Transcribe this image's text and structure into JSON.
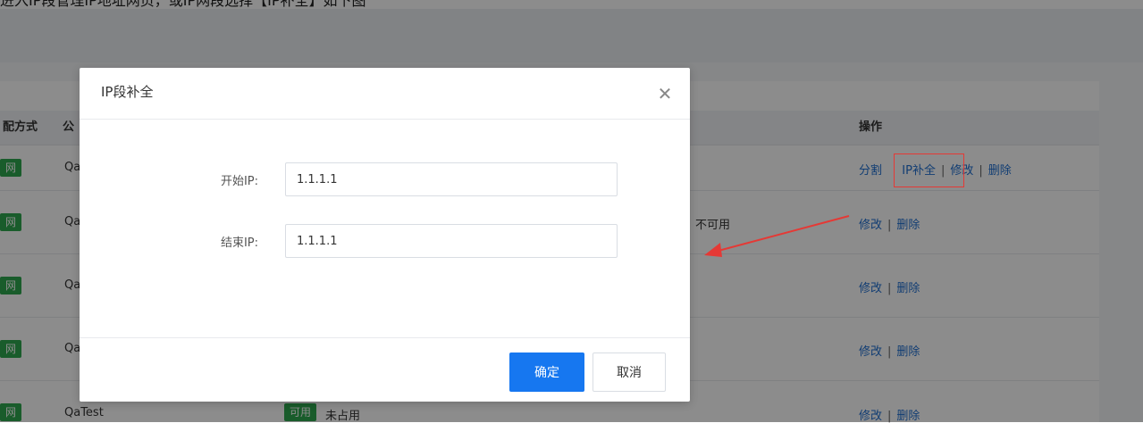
{
  "caption": "进入IP段管理IP地址网页，或IP网段选择【IP补全】如下图",
  "table": {
    "columns": [
      {
        "label": "配方式"
      },
      {
        "label": "公"
      },
      {
        "label": "操作"
      }
    ],
    "rows": [
      {
        "tag": "网",
        "name": "Qa",
        "status": "",
        "ops": [
          "分割",
          "IP补全",
          "修改",
          "删除"
        ]
      },
      {
        "tag": "网",
        "name": "Qa",
        "status": "不可用",
        "ops": [
          "修改",
          "删除"
        ]
      },
      {
        "tag": "网",
        "name": "Qa",
        "status": "",
        "ops": [
          "修改",
          "删除"
        ]
      },
      {
        "tag": "网",
        "name": "Qa",
        "status": "",
        "ops": [
          "修改",
          "删除"
        ]
      },
      {
        "tag": "网",
        "name": "QaTest",
        "badge": "可用",
        "status": "未占用",
        "ops": [
          "修改",
          "删除"
        ]
      }
    ]
  },
  "modal": {
    "title": "IP段补全",
    "start_label": "开始IP:",
    "start_value": "1.1.1.1",
    "end_label": "结束IP:",
    "end_value": "1.1.1.1",
    "confirm_label": "确定",
    "cancel_label": "取消"
  },
  "colors": {
    "primary": "#1677f0",
    "link": "#1f6fd1",
    "tag_green": "#2fa84f",
    "annotation_red": "#e53935"
  }
}
